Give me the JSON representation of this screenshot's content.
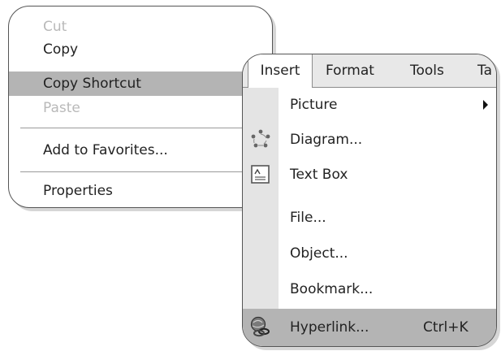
{
  "context_menu": {
    "items": [
      {
        "label": "Cut",
        "state": "disabled"
      },
      {
        "label": "Copy",
        "state": "normal"
      },
      {
        "label": "Copy Shortcut",
        "state": "highlighted"
      },
      {
        "label": "Paste",
        "state": "disabled"
      },
      {
        "label": "Add to Favorites...",
        "state": "normal"
      },
      {
        "label": "Properties",
        "state": "normal"
      }
    ]
  },
  "insert_menu": {
    "menubar": [
      "Insert",
      "Format",
      "Tools",
      "Ta"
    ],
    "items": [
      {
        "label": "Picture",
        "icon": "",
        "submenu": true
      },
      {
        "label": "Diagram...",
        "icon": "diagram-icon"
      },
      {
        "label": "Text Box",
        "icon": "text-box-icon"
      },
      {
        "label": "File..."
      },
      {
        "label": "Object..."
      },
      {
        "label": "Bookmark..."
      },
      {
        "label": "Hyperlink...",
        "shortcut": "Ctrl+K",
        "icon": "hyperlink-icon",
        "state": "highlighted"
      }
    ]
  },
  "colors": {
    "highlight": "#b4b4b4",
    "disabled_text": "#b9b9b9",
    "gutter": "#e4e4e4",
    "menubar": "#e8e8e8"
  }
}
